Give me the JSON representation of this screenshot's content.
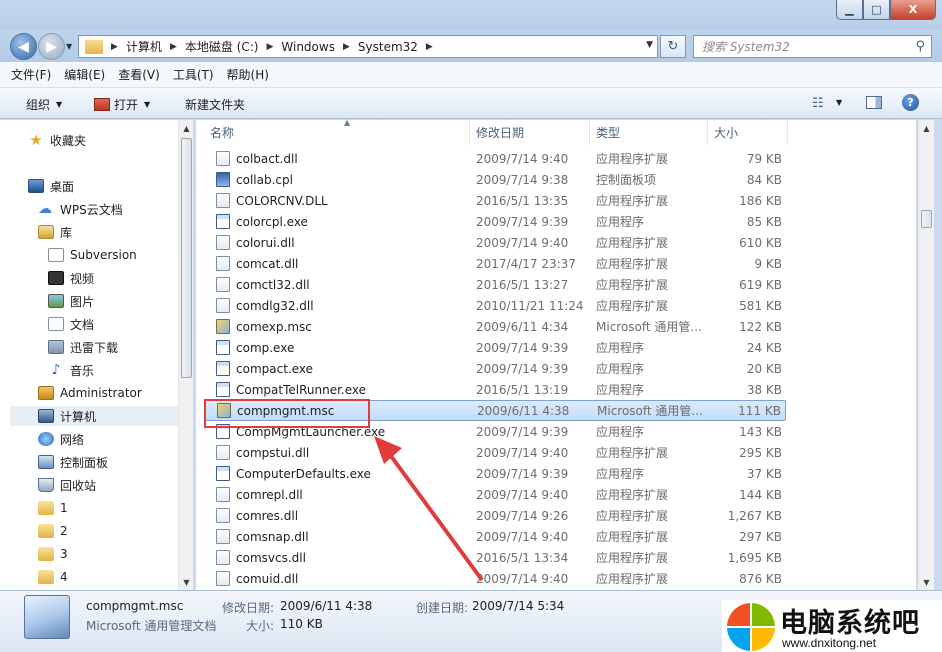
{
  "window": {
    "buttons": {
      "minimize": "▁",
      "maximize": "□",
      "close": "X"
    }
  },
  "address": {
    "crumbs": [
      "计算机",
      "本地磁盘 (C:)",
      "Windows",
      "System32"
    ],
    "search_placeholder": "搜索 System32"
  },
  "menu": [
    "文件(F)",
    "编辑(E)",
    "查看(V)",
    "工具(T)",
    "帮助(H)"
  ],
  "commands": {
    "organize": "组织",
    "open": "打开",
    "new_folder": "新建文件夹"
  },
  "nav": {
    "items": [
      {
        "label": "收藏夹",
        "icon": "star-icon"
      },
      {
        "label": "桌面",
        "icon": "desktop-icon"
      },
      {
        "label": "WPS云文档",
        "icon": "cloud-icon"
      },
      {
        "label": "库",
        "icon": "library-icon"
      },
      {
        "label": "Subversion",
        "icon": "svn-icon"
      },
      {
        "label": "视频",
        "icon": "video-icon"
      },
      {
        "label": "图片",
        "icon": "picture-icon"
      },
      {
        "label": "文档",
        "icon": "document-icon"
      },
      {
        "label": "迅雷下载",
        "icon": "download-icon"
      },
      {
        "label": "音乐",
        "icon": "music-icon"
      },
      {
        "label": "Administrator",
        "icon": "user-folder-icon"
      },
      {
        "label": "计算机",
        "icon": "computer-icon"
      },
      {
        "label": "网络",
        "icon": "network-icon"
      },
      {
        "label": "控制面板",
        "icon": "control-panel-icon"
      },
      {
        "label": "回收站",
        "icon": "recycle-bin-icon"
      },
      {
        "label": "1",
        "icon": "folder-icon"
      },
      {
        "label": "2",
        "icon": "folder-icon"
      },
      {
        "label": "3",
        "icon": "folder-icon"
      },
      {
        "label": "4",
        "icon": "folder-icon"
      }
    ]
  },
  "columns": {
    "name": "名称",
    "date": "修改日期",
    "type": "类型",
    "size": "大小"
  },
  "files": [
    {
      "name": "colbact.dll",
      "date": "2009/7/14 9:40",
      "type": "应用程序扩展",
      "size": "79 KB",
      "kind": "dll"
    },
    {
      "name": "collab.cpl",
      "date": "2009/7/14 9:38",
      "type": "控制面板项",
      "size": "84 KB",
      "kind": "cpl"
    },
    {
      "name": "COLORCNV.DLL",
      "date": "2016/5/1 13:35",
      "type": "应用程序扩展",
      "size": "186 KB",
      "kind": "dll"
    },
    {
      "name": "colorcpl.exe",
      "date": "2009/7/14 9:39",
      "type": "应用程序",
      "size": "85 KB",
      "kind": "exe"
    },
    {
      "name": "colorui.dll",
      "date": "2009/7/14 9:40",
      "type": "应用程序扩展",
      "size": "610 KB",
      "kind": "dll"
    },
    {
      "name": "comcat.dll",
      "date": "2017/4/17 23:37",
      "type": "应用程序扩展",
      "size": "9 KB",
      "kind": "dll"
    },
    {
      "name": "comctl32.dll",
      "date": "2016/5/1 13:27",
      "type": "应用程序扩展",
      "size": "619 KB",
      "kind": "dll"
    },
    {
      "name": "comdlg32.dll",
      "date": "2010/11/21 11:24",
      "type": "应用程序扩展",
      "size": "581 KB",
      "kind": "dll"
    },
    {
      "name": "comexp.msc",
      "date": "2009/6/11 4:34",
      "type": "Microsoft 通用管...",
      "size": "122 KB",
      "kind": "msc"
    },
    {
      "name": "comp.exe",
      "date": "2009/7/14 9:39",
      "type": "应用程序",
      "size": "24 KB",
      "kind": "exe"
    },
    {
      "name": "compact.exe",
      "date": "2009/7/14 9:39",
      "type": "应用程序",
      "size": "20 KB",
      "kind": "exe"
    },
    {
      "name": "CompatTelRunner.exe",
      "date": "2016/5/1 13:19",
      "type": "应用程序",
      "size": "38 KB",
      "kind": "exe"
    },
    {
      "name": "compmgmt.msc",
      "date": "2009/6/11 4:38",
      "type": "Microsoft 通用管...",
      "size": "111 KB",
      "kind": "msc",
      "selected": true
    },
    {
      "name": "CompMgmtLauncher.exe",
      "date": "2009/7/14 9:39",
      "type": "应用程序",
      "size": "143 KB",
      "kind": "exe"
    },
    {
      "name": "compstui.dll",
      "date": "2009/7/14 9:40",
      "type": "应用程序扩展",
      "size": "295 KB",
      "kind": "dll"
    },
    {
      "name": "ComputerDefaults.exe",
      "date": "2009/7/14 9:39",
      "type": "应用程序",
      "size": "37 KB",
      "kind": "exe"
    },
    {
      "name": "comrepl.dll",
      "date": "2009/7/14 9:40",
      "type": "应用程序扩展",
      "size": "144 KB",
      "kind": "dll"
    },
    {
      "name": "comres.dll",
      "date": "2009/7/14 9:26",
      "type": "应用程序扩展",
      "size": "1,267 KB",
      "kind": "dll"
    },
    {
      "name": "comsnap.dll",
      "date": "2009/7/14 9:40",
      "type": "应用程序扩展",
      "size": "297 KB",
      "kind": "dll"
    },
    {
      "name": "comsvcs.dll",
      "date": "2016/5/1 13:34",
      "type": "应用程序扩展",
      "size": "1,695 KB",
      "kind": "dll"
    },
    {
      "name": "comuid.dll",
      "date": "2009/7/14 9:40",
      "type": "应用程序扩展",
      "size": "876 KB",
      "kind": "dll"
    }
  ],
  "details": {
    "name": "compmgmt.msc",
    "type": "Microsoft 通用管理文档",
    "modified_label": "修改日期:",
    "modified": "2009/6/11 4:38",
    "created_label": "创建日期:",
    "created": "2009/7/14 5:34",
    "size_label": "大小:",
    "size": "110 KB"
  },
  "watermark": {
    "title": "电脑系统吧",
    "url": "www.dnxitong.net"
  },
  "colors": {
    "selection": "#c1dcfb",
    "highlight_box": "#e23b3b",
    "annotation_arrow": "#e23b3b"
  }
}
